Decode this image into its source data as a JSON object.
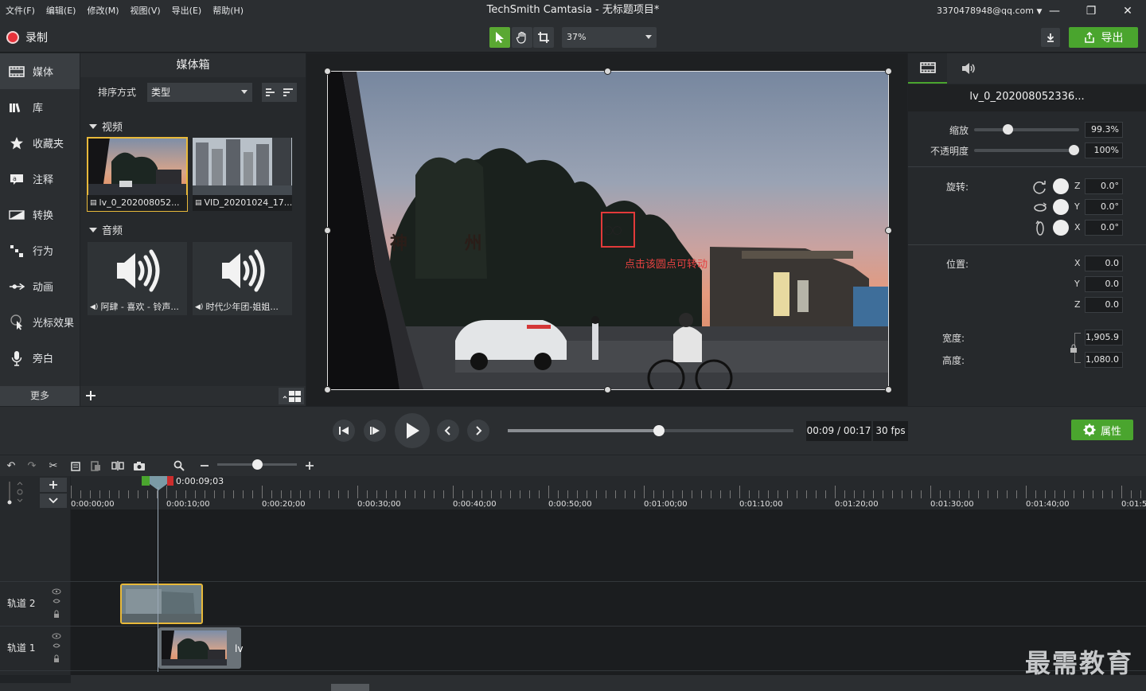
{
  "menu": [
    "文件(F)",
    "编辑(E)",
    "修改(M)",
    "视图(V)",
    "导出(E)",
    "帮助(H)"
  ],
  "app_title": "TechSmith Camtasia - 无标题项目*",
  "account": "3370478948@qq.com",
  "window": {
    "minimize": "—",
    "restore": "❐",
    "close": "✕"
  },
  "toolbar": {
    "record": "录制",
    "zoom": "37%",
    "export": "导出"
  },
  "sidebar": {
    "items": [
      "媒体",
      "库",
      "收藏夹",
      "注释",
      "转换",
      "行为",
      "动画",
      "光标效果",
      "旁白"
    ],
    "more": "更多"
  },
  "mediabin": {
    "title": "媒体箱",
    "sort_label": "排序方式",
    "sort_value": "类型",
    "video_section": "视频",
    "audio_section": "音频",
    "videos": [
      "lv_0_202008052...",
      "VID_20201024_17..."
    ],
    "audios": [
      "阿肆 - 喜欢 - 铃声...",
      "时代少年团-姐姐..."
    ]
  },
  "canvas": {
    "note": "点击该圆点可转动",
    "sign_text": "神 州"
  },
  "props": {
    "title": "lv_0_202008052336...",
    "scale_label": "缩放",
    "scale_value": "99.3%",
    "scale_level": 0.3,
    "opacity_label": "不透明度",
    "opacity_value": "100%",
    "opacity_level": 1.0,
    "rotation_label": "旋转:",
    "rot_z": "0.0°",
    "rot_y": "0.0°",
    "rot_x": "0.0°",
    "position_label": "位置:",
    "pos_x": "0.0",
    "pos_y": "0.0",
    "pos_z": "0.0",
    "width_label": "宽度:",
    "width_value": "1,905.9",
    "height_label": "高度:",
    "height_value": "1,080.0",
    "axis_z": "Z",
    "axis_y": "Y",
    "axis_x": "X"
  },
  "playback": {
    "time": "00:09 / 00:17",
    "fps": "30 fps",
    "progress": 0.53,
    "props_button": "属性"
  },
  "timeline": {
    "playhead": "0:00:09;03",
    "ticks": [
      "0:00:00;00",
      "0:00:10;00",
      "0:00:20;00",
      "0:00:30;00",
      "0:00:40;00",
      "0:00:50;00",
      "0:01:00;00",
      "0:01:10;00",
      "0:01:20;00",
      "0:01:30;00",
      "0:01:40;00",
      "0:01:5"
    ],
    "track2": "轨道 2",
    "track1": "轨道 1",
    "clip1_label": "lv"
  },
  "watermark": "最需教育",
  "colors": {
    "accent_green": "#4aa52e",
    "record_red": "#e8323b",
    "selection_yellow": "#e8b93a",
    "annotation_red": "#e23a3a"
  }
}
